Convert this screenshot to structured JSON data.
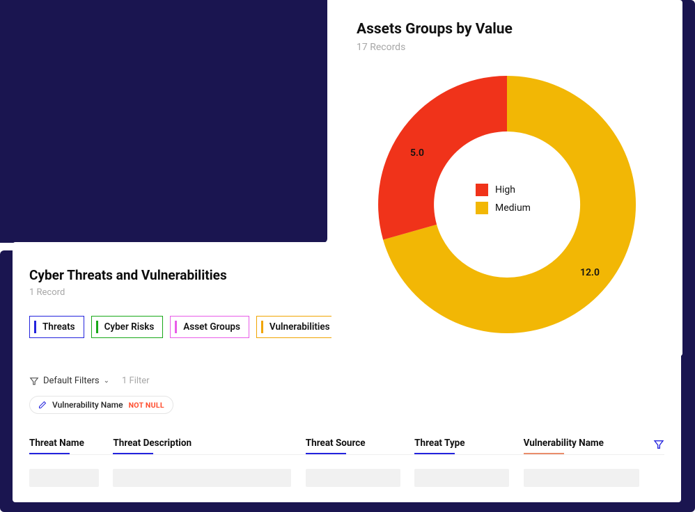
{
  "chart": {
    "title": "Assets Groups by Value",
    "subtitle": "17 Records",
    "legend": {
      "high": "High",
      "medium": "Medium"
    },
    "labels": {
      "high": "5.0",
      "medium": "12.0"
    },
    "colors": {
      "high": "#f0331a",
      "medium": "#f2b705"
    }
  },
  "chart_data": {
    "type": "pie",
    "title": "Assets Groups by Value",
    "categories": [
      "High",
      "Medium"
    ],
    "values": [
      5.0,
      12.0
    ],
    "colors": [
      "#f0331a",
      "#f2b705"
    ],
    "total_records": 17
  },
  "bottom": {
    "title": "Cyber Threats and Vulnerabilities",
    "subtitle": "1 Record",
    "tabs": {
      "threats": "Threats",
      "cyber_risks": "Cyber Risks",
      "asset_groups": "Asset Groups",
      "vulnerabilities": "Vulnerabilities"
    },
    "filters": {
      "default_label": "Default Filters",
      "count_label": "1 Filter",
      "chip_name": "Vulnerability Name",
      "chip_badge": "NOT NULL"
    },
    "columns": {
      "c1": "Threat Name",
      "c2": "Threat Description",
      "c3": "Threat Source",
      "c4": "Threat Type",
      "c5": "Vulnerability Name"
    }
  }
}
